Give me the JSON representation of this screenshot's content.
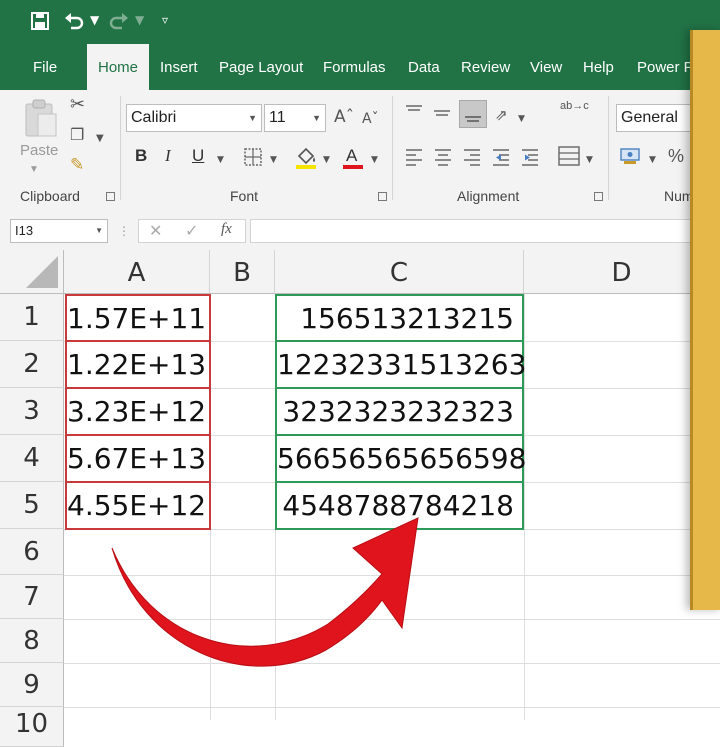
{
  "quick_access": {
    "save_icon": "save-icon",
    "undo_icon": "undo-icon",
    "redo_icon": "redo-icon"
  },
  "tabs": [
    {
      "label": "File"
    },
    {
      "label": "Home"
    },
    {
      "label": "Insert"
    },
    {
      "label": "Page Layout"
    },
    {
      "label": "Formulas"
    },
    {
      "label": "Data"
    },
    {
      "label": "Review"
    },
    {
      "label": "View"
    },
    {
      "label": "Help"
    },
    {
      "label": "Power Pi"
    }
  ],
  "ribbon": {
    "clipboard": {
      "paste_label": "Paste",
      "group_label": "Clipboard"
    },
    "font": {
      "font_name": "Calibri",
      "font_size": "11",
      "bold": "B",
      "italic": "I",
      "underline": "U",
      "group_label": "Font"
    },
    "alignment": {
      "group_label": "Alignment",
      "wrap_glyph": "ab→c"
    },
    "number": {
      "format": "General",
      "percent": "%",
      "group_label": "Numb"
    }
  },
  "formula_bar": {
    "name_box": "I13",
    "fx": "fx"
  },
  "columns": [
    "A",
    "B",
    "C",
    "D"
  ],
  "rows": [
    "1",
    "2",
    "3",
    "4",
    "5",
    "6",
    "7",
    "8",
    "9",
    "10"
  ],
  "cells": {
    "A": [
      "1.57E+11",
      "1.22E+13",
      "3.23E+12",
      "5.67E+13",
      "4.55E+12"
    ],
    "C": [
      "156513213215",
      "12232331513263",
      "3232323232323",
      "56656565656598",
      "4548788784218"
    ]
  },
  "colors": {
    "excel_green": "#217346",
    "arrow_red": "#e0141c",
    "highlight_red": "#c83a3a",
    "highlight_green": "#2e9a57"
  }
}
